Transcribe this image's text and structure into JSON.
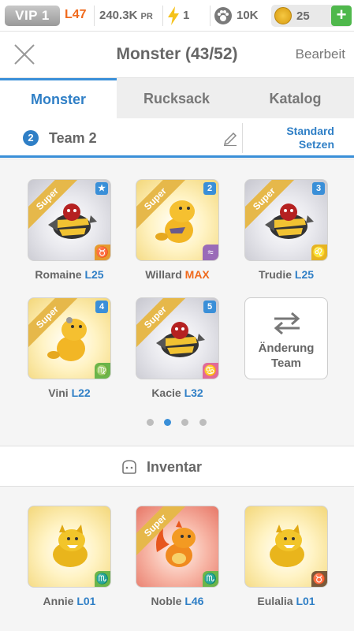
{
  "status_bar": {
    "vip": "VIP 1",
    "level": "L47",
    "power": "240.3K",
    "power_unit": "PR",
    "energy": "1",
    "paws": "10K",
    "coins": "25",
    "plus": "+"
  },
  "header": {
    "title": "Monster (43/52)",
    "edit_label": "Bearbeit"
  },
  "tabs": [
    {
      "label": "Monster",
      "active": true
    },
    {
      "label": "Rucksack",
      "active": false
    },
    {
      "label": "Katalog",
      "active": false
    }
  ],
  "team": {
    "number": "2",
    "name": "Team 2",
    "standard_line1": "Standard",
    "standard_line2": "Setzen"
  },
  "team_monsters": [
    {
      "name": "Romaine",
      "level": "L25",
      "ribbon": "Super",
      "badge": "★",
      "zodiac": "♉"
    },
    {
      "name": "Willard",
      "level": "MAX",
      "ribbon": "Super",
      "badge": "2",
      "zodiac": "≈"
    },
    {
      "name": "Trudie",
      "level": "L25",
      "ribbon": "Super",
      "badge": "3",
      "zodiac": "♌"
    },
    {
      "name": "Vini",
      "level": "L22",
      "ribbon": "Super",
      "badge": "4",
      "zodiac": "♍"
    },
    {
      "name": "Kacie",
      "level": "L32",
      "ribbon": "Super",
      "badge": "5",
      "zodiac": "♋"
    }
  ],
  "change_team": {
    "line1": "Änderung",
    "line2": "Team"
  },
  "pager": {
    "pages": 4,
    "active": 2
  },
  "inventory": {
    "title": "Inventar",
    "monsters": [
      {
        "name": "Annie",
        "level": "L01",
        "ribbon": "",
        "zodiac": "♏"
      },
      {
        "name": "Noble",
        "level": "L46",
        "ribbon": "Super",
        "zodiac": "♏"
      },
      {
        "name": "Eulalia",
        "level": "L01",
        "ribbon": "",
        "zodiac": "♉"
      }
    ]
  },
  "colors": {
    "accent": "#2f7fc6",
    "level_orange": "#f06a1d",
    "plus_green": "#4fb84c"
  }
}
